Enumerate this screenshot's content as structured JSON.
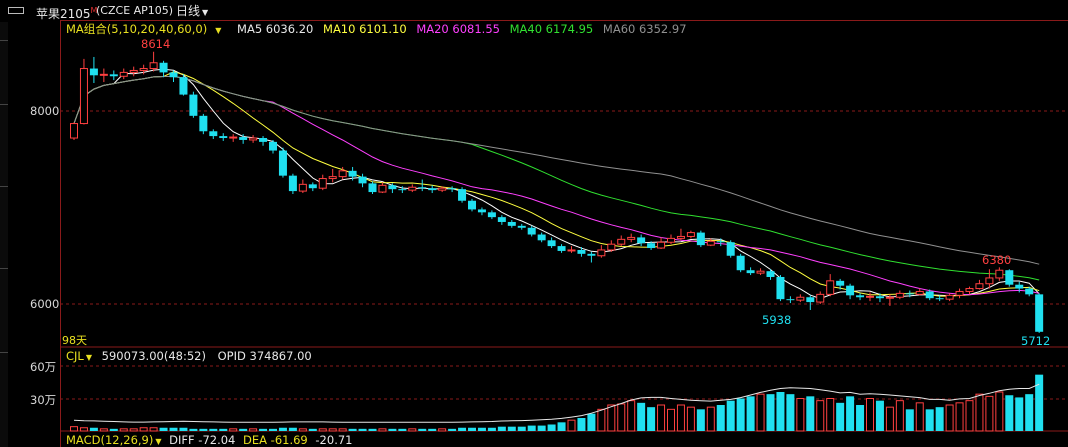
{
  "title": {
    "symbol": "苹果2105",
    "superscript": "M",
    "code": "(CZCE AP105)",
    "period": "日线"
  },
  "legend": {
    "group": "MA组合(5,10,20,40,60,0)",
    "ma5": "MA5 6036.20",
    "ma10": "MA10 6101.10",
    "ma20": "MA20 6081.55",
    "ma40": "MA40 6174.95",
    "ma60": "MA60 6352.97"
  },
  "colors": {
    "up": "#ff4040",
    "down": "#20e0f0",
    "ma5": "#ffffff",
    "ma10": "#ffff40",
    "ma20": "#ff40ff",
    "ma40": "#30e030",
    "ma60": "#909090",
    "grid": "#8a1a1a",
    "high_label": "#ff4040",
    "low_label": "#20e0f0"
  },
  "axes": {
    "price_ticks": [
      "8000",
      "6000"
    ],
    "volume_ticks": [
      "60万",
      "30万"
    ]
  },
  "count_label": "98天",
  "volume_legend": {
    "name": "CJL",
    "value": "590073.00(48:52)",
    "opid": "OPID 374867.00"
  },
  "macd_legend": {
    "name": "MACD(12,26,9)",
    "diff": "DIFF -72.04",
    "dea": "DEA -61.69",
    "macd": "-20.71"
  },
  "annotations": {
    "high": "8614",
    "low_mid": "5938",
    "high_recent": "6380",
    "low_last": "5712"
  },
  "chart_data": {
    "type": "candlestick",
    "price_range": [
      5712,
      8614
    ],
    "volume_range_wan": [
      0,
      60
    ],
    "series_names": [
      "MA5",
      "MA10",
      "MA20",
      "MA40",
      "MA60"
    ],
    "candles": [
      [
        7720,
        7870,
        7700,
        7880
      ],
      [
        7870,
        8440,
        7860,
        8540
      ],
      [
        8440,
        8370,
        8290,
        8560
      ],
      [
        8370,
        8380,
        8300,
        8440
      ],
      [
        8380,
        8360,
        8320,
        8420
      ],
      [
        8360,
        8400,
        8330,
        8440
      ],
      [
        8400,
        8420,
        8360,
        8460
      ],
      [
        8420,
        8440,
        8380,
        8480
      ],
      [
        8440,
        8500,
        8410,
        8614
      ],
      [
        8500,
        8400,
        8350,
        8520
      ],
      [
        8400,
        8350,
        8300,
        8420
      ],
      [
        8350,
        8170,
        8160,
        8380
      ],
      [
        8170,
        7950,
        7930,
        8200
      ],
      [
        7950,
        7790,
        7760,
        7970
      ],
      [
        7790,
        7740,
        7710,
        7810
      ],
      [
        7740,
        7720,
        7690,
        7770
      ],
      [
        7720,
        7730,
        7680,
        7760
      ],
      [
        7730,
        7700,
        7660,
        7760
      ],
      [
        7700,
        7720,
        7670,
        7750
      ],
      [
        7720,
        7680,
        7640,
        7740
      ],
      [
        7680,
        7590,
        7560,
        7700
      ],
      [
        7590,
        7330,
        7310,
        7620
      ],
      [
        7330,
        7170,
        7140,
        7350
      ],
      [
        7170,
        7240,
        7150,
        7290
      ],
      [
        7240,
        7200,
        7170,
        7260
      ],
      [
        7200,
        7300,
        7180,
        7340
      ],
      [
        7300,
        7320,
        7260,
        7400
      ],
      [
        7320,
        7380,
        7290,
        7420
      ],
      [
        7380,
        7320,
        7280,
        7420
      ],
      [
        7320,
        7250,
        7210,
        7350
      ],
      [
        7250,
        7160,
        7140,
        7270
      ],
      [
        7160,
        7230,
        7150,
        7260
      ],
      [
        7230,
        7190,
        7150,
        7250
      ],
      [
        7190,
        7180,
        7150,
        7220
      ],
      [
        7180,
        7210,
        7160,
        7240
      ],
      [
        7210,
        7200,
        7170,
        7290
      ],
      [
        7200,
        7180,
        7150,
        7230
      ],
      [
        7180,
        7200,
        7160,
        7220
      ],
      [
        7200,
        7190,
        7160,
        7220
      ],
      [
        7190,
        7070,
        7050,
        7210
      ],
      [
        7070,
        6980,
        6960,
        7090
      ],
      [
        6980,
        6950,
        6920,
        7000
      ],
      [
        6950,
        6900,
        6880,
        6970
      ],
      [
        6900,
        6850,
        6820,
        6920
      ],
      [
        6850,
        6810,
        6790,
        6870
      ],
      [
        6810,
        6790,
        6770,
        6830
      ],
      [
        6790,
        6720,
        6700,
        6810
      ],
      [
        6720,
        6660,
        6640,
        6740
      ],
      [
        6660,
        6600,
        6580,
        6690
      ],
      [
        6600,
        6550,
        6530,
        6620
      ],
      [
        6550,
        6560,
        6530,
        6600
      ],
      [
        6560,
        6520,
        6490,
        6590
      ],
      [
        6520,
        6500,
        6430,
        6540
      ],
      [
        6500,
        6560,
        6480,
        6610
      ],
      [
        6560,
        6620,
        6540,
        6660
      ],
      [
        6620,
        6670,
        6600,
        6710
      ],
      [
        6670,
        6690,
        6640,
        6730
      ],
      [
        6690,
        6630,
        6600,
        6720
      ],
      [
        6630,
        6580,
        6560,
        6650
      ],
      [
        6580,
        6640,
        6570,
        6690
      ],
      [
        6640,
        6680,
        6620,
        6720
      ],
      [
        6680,
        6700,
        6660,
        6780
      ],
      [
        6700,
        6740,
        6680,
        6760
      ],
      [
        6740,
        6610,
        6590,
        6760
      ],
      [
        6610,
        6650,
        6600,
        6680
      ],
      [
        6650,
        6640,
        6600,
        6680
      ],
      [
        6640,
        6500,
        6480,
        6660
      ],
      [
        6500,
        6350,
        6330,
        6520
      ],
      [
        6350,
        6320,
        6300,
        6380
      ],
      [
        6320,
        6340,
        6300,
        6370
      ],
      [
        6340,
        6280,
        6250,
        6360
      ],
      [
        6280,
        6050,
        6030,
        6300
      ],
      [
        6050,
        6040,
        6010,
        6080
      ],
      [
        6040,
        6070,
        6020,
        6100
      ],
      [
        6070,
        6020,
        5938,
        6090
      ],
      [
        6020,
        6100,
        6000,
        6130
      ],
      [
        6100,
        6240,
        6080,
        6310
      ],
      [
        6240,
        6190,
        6150,
        6260
      ],
      [
        6190,
        6090,
        6050,
        6210
      ],
      [
        6090,
        6070,
        6040,
        6110
      ],
      [
        6070,
        6080,
        6030,
        6120
      ],
      [
        6080,
        6060,
        6020,
        6110
      ],
      [
        6060,
        6070,
        5980,
        6100
      ],
      [
        6070,
        6110,
        6050,
        6140
      ],
      [
        6110,
        6100,
        6070,
        6140
      ],
      [
        6100,
        6130,
        6090,
        6160
      ],
      [
        6130,
        6060,
        6040,
        6150
      ],
      [
        6060,
        6050,
        6030,
        6090
      ],
      [
        6050,
        6090,
        6030,
        6110
      ],
      [
        6090,
        6130,
        6060,
        6160
      ],
      [
        6130,
        6160,
        6100,
        6180
      ],
      [
        6160,
        6210,
        6150,
        6250
      ],
      [
        6210,
        6270,
        6160,
        6360
      ],
      [
        6270,
        6350,
        6240,
        6380
      ],
      [
        6350,
        6200,
        6180,
        6360
      ],
      [
        6200,
        6160,
        6120,
        6230
      ],
      [
        6160,
        6100,
        6080,
        6180
      ],
      [
        6100,
        5712,
        5700,
        6110
      ]
    ],
    "volume_wan": [
      4,
      3,
      3,
      2,
      2,
      2,
      2,
      3,
      3,
      3,
      3,
      3,
      2,
      2,
      2,
      2,
      2,
      2,
      2,
      2,
      2,
      3,
      3,
      2,
      2,
      2,
      2,
      2,
      2,
      2,
      2,
      2,
      2,
      2,
      2,
      2,
      2,
      2,
      2,
      3,
      3,
      3,
      3,
      4,
      4,
      4,
      5,
      5,
      6,
      8,
      10,
      12,
      16,
      20,
      24,
      25,
      28,
      26,
      22,
      24,
      20,
      24,
      22,
      20,
      22,
      24,
      28,
      30,
      32,
      34,
      34,
      36,
      34,
      30,
      32,
      28,
      30,
      26,
      32,
      24,
      30,
      28,
      22,
      28,
      20,
      26,
      20,
      22,
      24,
      26,
      28,
      34,
      32,
      36,
      33,
      31,
      34,
      52
    ]
  }
}
